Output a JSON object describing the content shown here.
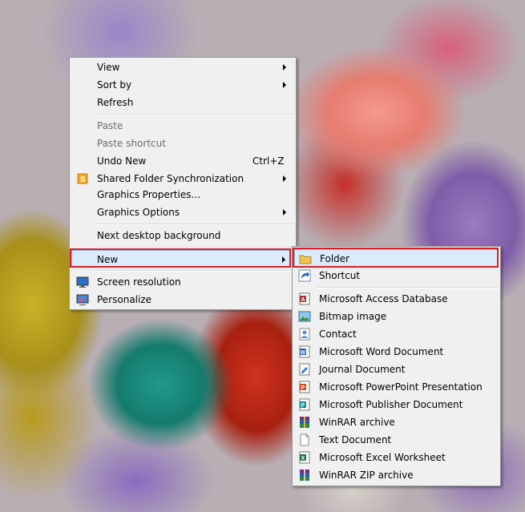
{
  "desktop": {
    "wallpaper": "decorative string lights photo"
  },
  "context_menu": {
    "items": {
      "view": "View",
      "sort_by": "Sort by",
      "refresh": "Refresh",
      "paste": "Paste",
      "paste_shortcut": "Paste shortcut",
      "undo_new": "Undo New",
      "undo_new_shortcut": "Ctrl+Z",
      "shared_folder_sync": "Shared Folder Synchronization",
      "graphics_properties": "Graphics Properties...",
      "graphics_options": "Graphics Options",
      "next_desktop_background": "Next desktop background",
      "new": "New",
      "screen_resolution": "Screen resolution",
      "personalize": "Personalize"
    }
  },
  "new_submenu": {
    "items": {
      "folder": "Folder",
      "shortcut": "Shortcut",
      "access_database": "Microsoft Access Database",
      "bitmap_image": "Bitmap image",
      "contact": "Contact",
      "word_document": "Microsoft Word Document",
      "journal_document": "Journal Document",
      "powerpoint_presentation": "Microsoft PowerPoint Presentation",
      "publisher_document": "Microsoft Publisher Document",
      "winrar_archive": "WinRAR archive",
      "text_document": "Text Document",
      "excel_worksheet": "Microsoft Excel Worksheet",
      "winrar_zip_archive": "WinRAR ZIP archive"
    }
  },
  "colors": {
    "highlight_outline": "#d4202c",
    "menu_background": "#f0f0f0",
    "hover_background": "#dcebfc"
  }
}
